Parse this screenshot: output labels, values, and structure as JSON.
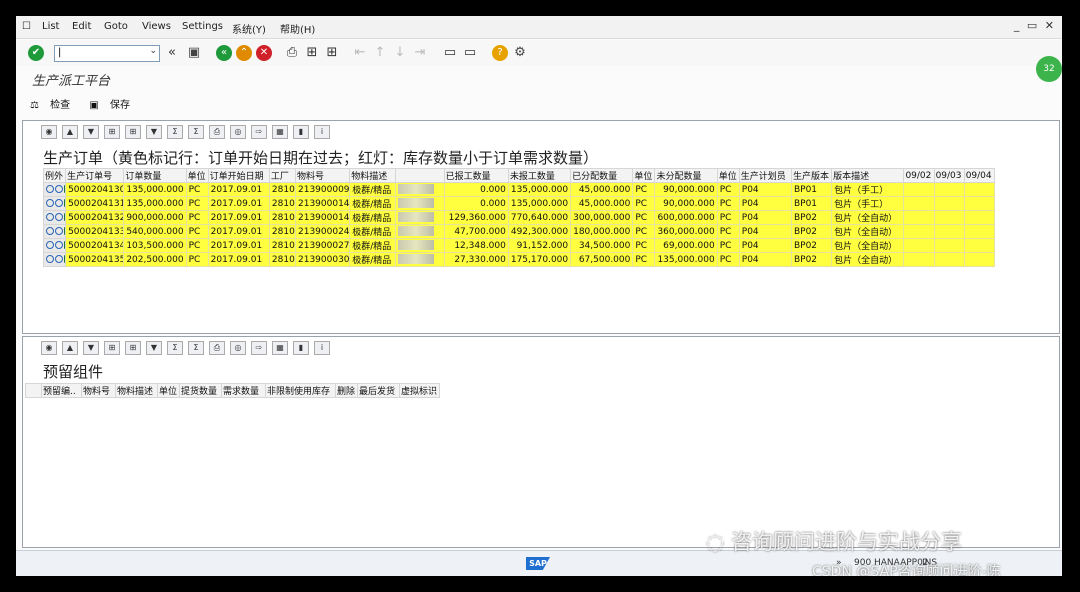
{
  "menu": [
    "List",
    "Edit",
    "Goto",
    "Views",
    "Settings",
    "系统(Y)",
    "帮助(H)"
  ],
  "window_controls": "_ ▭ ✕",
  "screen_title": "生产派工平台",
  "app_toolbar": {
    "check": "检查",
    "save": "保存"
  },
  "upper": {
    "title": "生产订单（黄色标记行：订单开始日期在过去；红灯：库存数量小于订单需求数量）",
    "headers": [
      "例外",
      "生产订单号",
      "订单数量",
      "单位",
      "订单开始日期",
      "工厂",
      "物料号",
      "物料描述",
      "",
      "已报工数量",
      "未报工数量",
      "已分配数量",
      "单位",
      "未分配数量",
      "单位",
      "生产计划员",
      "生产版本",
      "版本描述",
      "09/02",
      "09/03",
      "09/04"
    ],
    "rows": [
      [
        "5000204130",
        "135,000.000",
        "PC",
        "2017.09.01",
        "2810",
        "213900009",
        "极群/精品",
        "0.000",
        "135,000.000",
        "45,000.000",
        "PC",
        "90,000.000",
        "PC",
        "P04",
        "BP01",
        "包片（手工）"
      ],
      [
        "5000204131",
        "135,000.000",
        "PC",
        "2017.09.01",
        "2810",
        "213900014",
        "极群/精品",
        "0.000",
        "135,000.000",
        "45,000.000",
        "PC",
        "90,000.000",
        "PC",
        "P04",
        "BP01",
        "包片（手工）"
      ],
      [
        "5000204132",
        "900,000.000",
        "PC",
        "2017.09.01",
        "2810",
        "213900014",
        "极群/精品",
        "129,360.000",
        "770,640.000",
        "300,000.000",
        "PC",
        "600,000.000",
        "PC",
        "P04",
        "BP02",
        "包片（全自动）"
      ],
      [
        "5000204133",
        "540,000.000",
        "PC",
        "2017.09.01",
        "2810",
        "213900024",
        "极群/精品",
        "47,700.000",
        "492,300.000",
        "180,000.000",
        "PC",
        "360,000.000",
        "PC",
        "P04",
        "BP02",
        "包片（全自动）"
      ],
      [
        "5000204134",
        "103,500.000",
        "PC",
        "2017.09.01",
        "2810",
        "213900027",
        "极群/精品",
        "12,348.000",
        "91,152.000",
        "34,500.000",
        "PC",
        "69,000.000",
        "PC",
        "P04",
        "BP02",
        "包片（全自动）"
      ],
      [
        "5000204135",
        "202,500.000",
        "PC",
        "2017.09.01",
        "2810",
        "213900030",
        "极群/精品",
        "27,330.000",
        "175,170.000",
        "67,500.000",
        "PC",
        "135,000.000",
        "PC",
        "P04",
        "BP02",
        "包片（全自动）"
      ]
    ],
    "row_color": "#ffff40"
  },
  "lower": {
    "title": "预留组件",
    "headers": [
      "预留编..",
      "物料号",
      "物料描述",
      "单位",
      "提货数量",
      "需求数量",
      "非限制使用库存",
      "删除",
      "最后发货",
      "虚拟标识"
    ]
  },
  "status": {
    "client": "900",
    "server": "HANAAPP02",
    "mode": "INS"
  },
  "watermark": {
    "line1": "咨询顾问进阶与实战分享",
    "line2": "CSDN @SAP咨询顾问进阶-陈"
  },
  "badge": "32",
  "colors": {
    "accent": "#1e9a3a",
    "sap_blue": "#1f6fd1",
    "highlight": "#ffff40"
  }
}
